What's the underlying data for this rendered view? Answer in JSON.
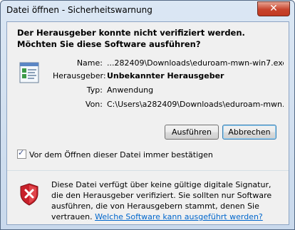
{
  "window": {
    "title": "Datei öffnen - Sicherheitswarnung",
    "close_label": "✕"
  },
  "heading": "Der Herausgeber konnte nicht verifiziert werden. Möchten Sie diese Software ausführen?",
  "details": [
    {
      "label": "Name:",
      "value": "...282409\\Downloads\\eduroam-mwn-win7.exe"
    },
    {
      "label": "Herausgeber:",
      "value": "Unbekannter Herausgeber"
    },
    {
      "label": "Typ:",
      "value": "Anwendung"
    },
    {
      "label": "Von:",
      "value": "C:\\Users\\a282409\\Downloads\\eduroam-mwn..."
    }
  ],
  "buttons": {
    "run": "Ausführen",
    "cancel": "Abbrechen"
  },
  "checkbox": {
    "label": "Vor dem Öffnen dieser Datei immer bestätigen",
    "checked": true
  },
  "warning": {
    "text": "Diese Datei verfügt über keine gültige digitale Signatur, die den Herausgeber verifiziert. Sie sollten nur Software ausführen, die von Herausgebern stammt, denen Sie vertrauen. ",
    "link": "Welche Software kann ausgeführt werden?"
  }
}
